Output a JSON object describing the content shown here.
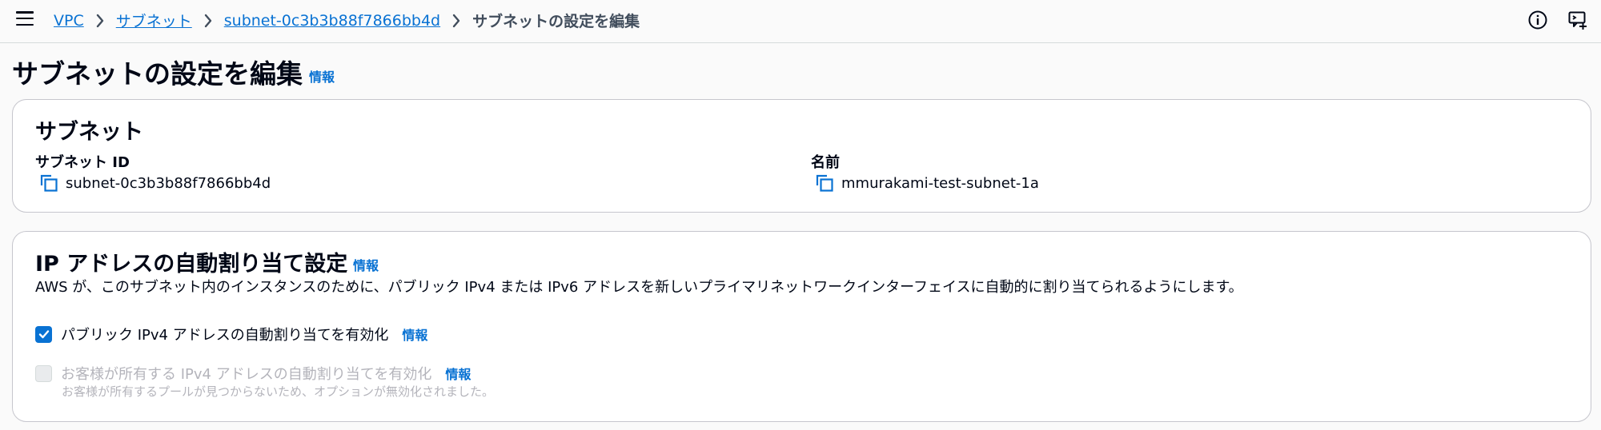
{
  "breadcrumb": {
    "items": [
      "VPC",
      "サブネット",
      "subnet-0c3b3b88f7866bb4d"
    ],
    "current": "サブネットの設定を編集"
  },
  "page": {
    "title": "サブネットの設定を編集",
    "info": "情報"
  },
  "subnet_card": {
    "title": "サブネット",
    "subnet_id_label": "サブネット ID",
    "subnet_id_value": "subnet-0c3b3b88f7866bb4d",
    "name_label": "名前",
    "name_value": "mmurakami-test-subnet-1a"
  },
  "ip_card": {
    "title": "IP アドレスの自動割り当て設定",
    "info": "情報",
    "description": "AWS が、このサブネット内のインスタンスのために、パブリック IPv4 または IPv6 アドレスを新しいプライマリネットワークインターフェイスに自動的に割り当てられるようにします。",
    "options": [
      {
        "label": "パブリック IPv4 アドレスの自動割り当てを有効化",
        "info": "情報",
        "checked": true,
        "disabled": false
      },
      {
        "label": "お客様が所有する IPv4 アドレスの自動割り当てを有効化",
        "info": "情報",
        "checked": false,
        "disabled": true
      }
    ],
    "disabled_hint": "お客様が所有するプールが見つからないため、オプションが無効化されました。"
  },
  "icons": [
    "menu-icon",
    "chevron-right-icon",
    "info-circle-icon",
    "feedback-icon",
    "copy-icon",
    "check-icon"
  ],
  "colors": {
    "link": "#0972d3",
    "text": "#000716",
    "disabled": "#b4b4bb",
    "border": "#c6c6cd"
  }
}
